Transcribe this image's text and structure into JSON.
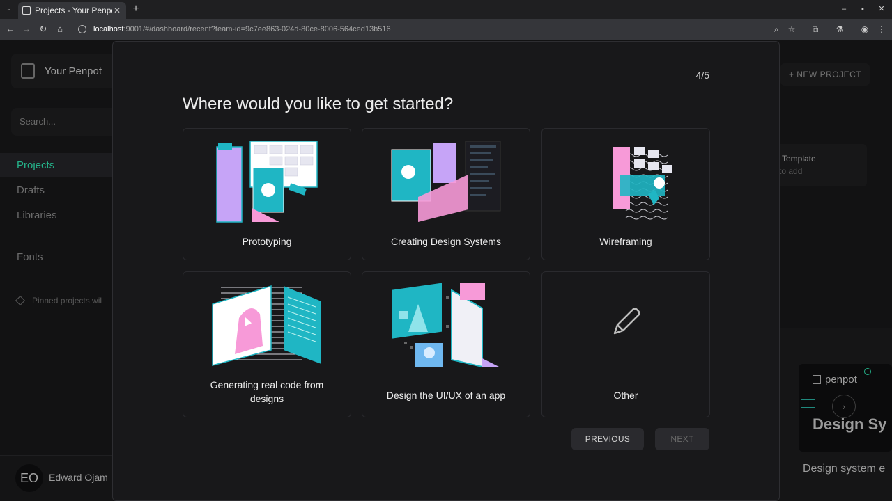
{
  "browser": {
    "tab_title": "Projects - Your Penpot",
    "url_host": "localhost",
    "url_rest": ":9001/#/dashboard/recent?team-id=9c7ee863-024d-80ce-8006-564ced13b516"
  },
  "sidebar": {
    "team_name": "Your Penpot",
    "search_placeholder": "Search...",
    "items": [
      {
        "label": "Projects"
      },
      {
        "label": "Drafts"
      },
      {
        "label": "Libraries"
      },
      {
        "label": "Fonts"
      }
    ],
    "pinned_text": "Pinned projects wil",
    "profile": {
      "initials": "EO",
      "name": "Edward Ojam"
    }
  },
  "dashboard": {
    "new_project_label": "+ NEW PROJECT",
    "template_title": "Template",
    "template_sub": "to add",
    "ds_logo": "penpot",
    "ds_big": "Design Sy",
    "ds_name": "Design system e"
  },
  "onboarding": {
    "step": "4/5",
    "question": "Where would you like to get started?",
    "options": [
      {
        "label": "Prototyping"
      },
      {
        "label": "Creating Design Systems"
      },
      {
        "label": "Wireframing"
      },
      {
        "label": "Generating real code from designs"
      },
      {
        "label": "Design the UI/UX of an app"
      },
      {
        "label": "Other"
      }
    ],
    "previous_label": "PREVIOUS",
    "next_label": "NEXT"
  },
  "colors": {
    "accent": "#31efb8",
    "teal": "#1fb6c4",
    "pink": "#f79ad8",
    "purple": "#c6a4f7"
  }
}
